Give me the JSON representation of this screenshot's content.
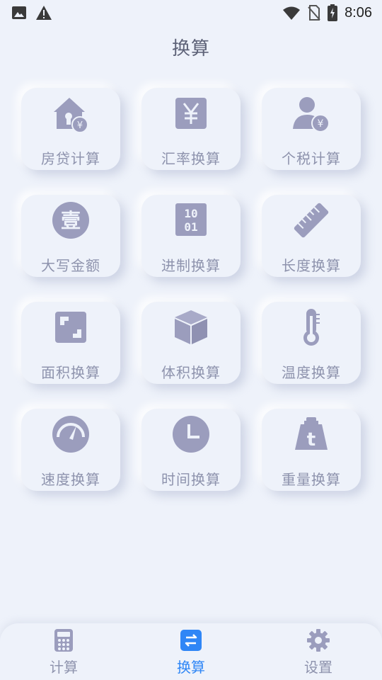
{
  "status_bar": {
    "time": "8:06",
    "left_icons": [
      "image-icon",
      "warning-icon"
    ],
    "right_icons": [
      "wifi-icon",
      "no-sim-icon",
      "battery-charging-icon"
    ]
  },
  "header": {
    "title": "换算"
  },
  "tiles": [
    {
      "label": "房贷计算",
      "icon": "house-yuan-icon"
    },
    {
      "label": "汇率换算",
      "icon": "yuan-square-icon"
    },
    {
      "label": "个税计算",
      "icon": "person-yuan-icon"
    },
    {
      "label": "大写金额",
      "icon": "capital-number-icon"
    },
    {
      "label": "进制换算",
      "icon": "binary-icon"
    },
    {
      "label": "长度换算",
      "icon": "ruler-icon"
    },
    {
      "label": "面积换算",
      "icon": "area-square-icon"
    },
    {
      "label": "体积换算",
      "icon": "cube-icon"
    },
    {
      "label": "温度换算",
      "icon": "thermometer-icon"
    },
    {
      "label": "速度换算",
      "icon": "speedometer-icon"
    },
    {
      "label": "时间换算",
      "icon": "clock-icon"
    },
    {
      "label": "重量换算",
      "icon": "weight-icon"
    }
  ],
  "icon_text": {
    "yuan": "¥",
    "capital_one": "壹",
    "binary_top": "10",
    "binary_bottom": "01",
    "weight_letter": "t"
  },
  "bottom_nav": {
    "items": [
      {
        "label": "计算",
        "icon": "calculator-icon",
        "active": false
      },
      {
        "label": "换算",
        "icon": "convert-icon",
        "active": true
      },
      {
        "label": "设置",
        "icon": "gear-icon",
        "active": false
      }
    ]
  },
  "colors": {
    "background": "#EEF2FA",
    "icon": "#9B9DBD",
    "label": "#8E93AD",
    "title": "#5E6378",
    "accent": "#2F86F6"
  }
}
